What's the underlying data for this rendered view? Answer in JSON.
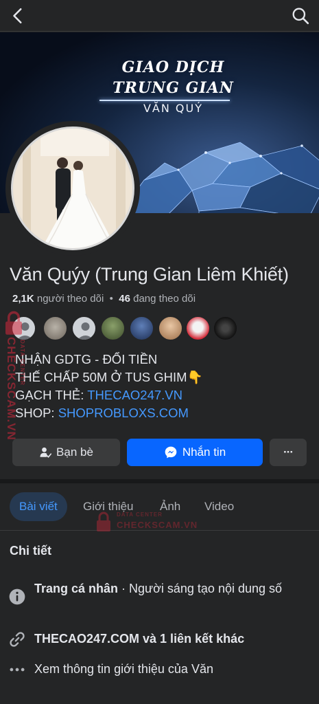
{
  "topbar": {
    "back_icon": "chevron-left-icon",
    "search_icon": "search-icon"
  },
  "cover": {
    "title_line1": "GIAO DỊCH",
    "title_line2": "TRUNG GIAN",
    "subtitle": "VĂN QUÝ"
  },
  "profile": {
    "name": "Văn Quýy (Trung Gian Liêm Khiết)",
    "followers_count": "2,1K",
    "followers_label": "người theo dõi",
    "separator": "•",
    "following_count": "46",
    "following_label": "đang theo dõi"
  },
  "bio": {
    "line1": "NHẬN GDTG - ĐỔI TIỀN",
    "line2": "THẾ CHẤP 50M Ở TUS GHIM👇",
    "line3_prefix": "GẠCH THẺ: ",
    "line3_link": "THECAO247.VN",
    "line4_prefix": "SHOP: ",
    "line4_link": "SHOPROBLOXS.COM"
  },
  "actions": {
    "friends_label": "Bạn bè",
    "message_label": "Nhắn tin",
    "more_label": "···"
  },
  "tabs": [
    {
      "label": "Bài viết",
      "active": true
    },
    {
      "label": "Giới thiệu",
      "active": false
    },
    {
      "label": "Ảnh",
      "active": false
    },
    {
      "label": "Video",
      "active": false
    }
  ],
  "details": {
    "title": "Chi tiết",
    "items": [
      {
        "icon": "info-icon",
        "bold": "Trang cá nhân",
        "rest": " · Người sáng tạo nội dung số"
      },
      {
        "icon": "link-icon",
        "bold": "THECAO247.COM và 1 liên kết khác",
        "rest": ""
      },
      {
        "icon": "more-horizontal-icon",
        "bold": "",
        "rest": "Xem thông tin giới thiệu của Văn"
      }
    ]
  },
  "watermarks": {
    "center_top": "DATA CENTER",
    "center_main": "CHECKSCAM.VN",
    "side_top": "DATA CENTER",
    "side_main": "CHECKSCAM.VN"
  },
  "colors": {
    "background": "#242526",
    "accent": "#0866ff",
    "link": "#4599ff",
    "secondary_button": "#3a3b3c"
  }
}
